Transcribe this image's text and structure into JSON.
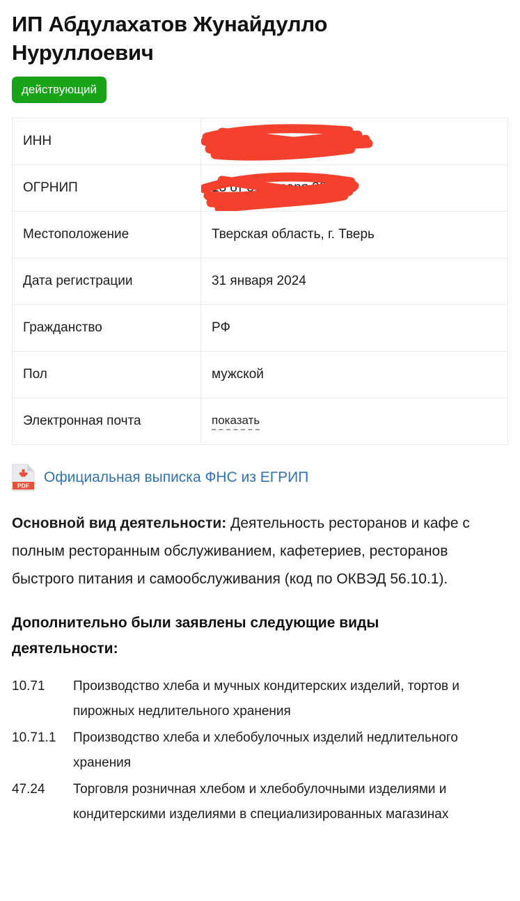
{
  "entity": {
    "title": "ИП Абдулахатов Жунайдулло Нуруллоевич",
    "status_label": "действующий",
    "status_color": "#19a319"
  },
  "details_table": {
    "rows": [
      {
        "label": "ИНН",
        "value": "",
        "redacted": true
      },
      {
        "label": "ОГРНИП",
        "value": "13 от 31 января 2024",
        "redacted": true
      },
      {
        "label": "Местоположение",
        "value": "Тверская область, г. Тверь",
        "redacted": false
      },
      {
        "label": "Дата регистрации",
        "value": "31 января 2024",
        "redacted": false
      },
      {
        "label": "Гражданство",
        "value": "РФ",
        "redacted": false
      },
      {
        "label": "Пол",
        "value": "мужской",
        "redacted": false
      },
      {
        "label": "Электронная почта",
        "value": "показать",
        "redacted": false
      }
    ]
  },
  "document_link": {
    "label": "Официальная выписка ФНС из ЕГРИП",
    "icon": "pdf-download-icon",
    "color": "#3072b5",
    "icon_badge_text": "PDF"
  },
  "main_activity": {
    "heading": "Основной вид деятельности:",
    "text": " Деятельность ресторанов и кафе с полным ресторанным обслуживанием, кафетериев, ресторанов быстрого питания и самообслуживания (код по ОКВЭД 56.10.1)."
  },
  "additional_activities": {
    "heading": "Дополнительно были заявлены следующие виды деятельности:",
    "items": [
      {
        "code": "10.71",
        "name": "Производство хлеба и мучных кондитерских изделий, тортов и пирожных недлительного хранения"
      },
      {
        "code": "10.71.1",
        "name": "Производство хлеба и хлебобулочных изделий недлительного хранения"
      },
      {
        "code": "47.24",
        "name": "Торговля розничная хлебом и хлебобулочными изделиями и кондитерскими изделиями в специализированных магазинах"
      }
    ]
  }
}
